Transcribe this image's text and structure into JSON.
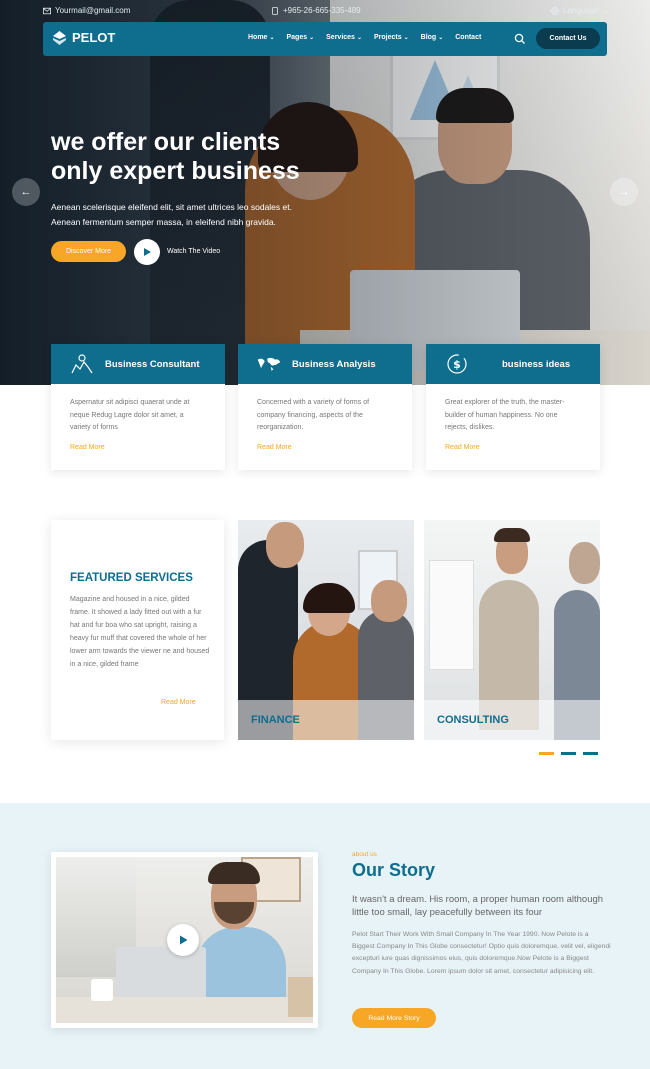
{
  "topbar": {
    "email": "Yourmail@gmail.com",
    "phone": "+965-26-665-335-489",
    "language": "Language"
  },
  "nav": {
    "brand": "PELOT",
    "links": [
      "Home",
      "Pages",
      "Services",
      "Projects",
      "Blog",
      "Contact"
    ],
    "contact_button": "Contact Us"
  },
  "hero": {
    "title_line1": "we offer our clients",
    "title_line2": "only expert business",
    "text_line1": "Aenean scelerisque eleifend elit, sit amet ultrices leo sodales et.",
    "text_line2": "Aenean fermentum semper massa, in eleifend nibh gravida.",
    "discover_button": "Discover More",
    "watch_label": "Watch The Video"
  },
  "services": [
    {
      "title": "Business Consultant",
      "icon": "person-chart-icon",
      "text": "Aspernatur sit adipisci quaerat unde at neque Redug Lagre dolor sit amet, a variety of forms",
      "read_more": "Read More"
    },
    {
      "title": "Business Analysis",
      "icon": "world-map-icon",
      "text": "Concerned with a variety of forms of company financing, aspects of the reorganization.",
      "read_more": "Read More"
    },
    {
      "title": "business ideas",
      "icon": "dollar-cycle-icon",
      "text": "Great explorer of the truth, the master-builder of human happiness. No one rejects, dislikes.",
      "read_more": "Read More"
    }
  ],
  "featured": {
    "title": "FEATURED SERVICES",
    "text": "Magazine and housed in a nice, gilded frame. It showed a lady fitted out with a fur hat and fur boa who sat upright, raising a heavy fur muff that covered the whole of her lower arm towards the viewer ne and housed in a nice, gilded frame",
    "read_more": "Read More",
    "cards": [
      {
        "caption": "FINANCE"
      },
      {
        "caption": "CONSULTING"
      }
    ]
  },
  "story": {
    "label": "about us",
    "title": "Our Story",
    "lead": "It wasn't a dream. His room, a proper human room although little too small, lay peacefully between its four",
    "text": "Pelot Start Their Work With Small Company In The Year 1990. Now Pelote is a Biggest Company In This Globe consectetur! Optio quis doloremque, velit vel, eligendi excepturi iure quas dignissimos eius, quis doloremque.Now Pelote is a Biggest Company In This Globe. Lorem ipsum dolor sit amet, consectetur adipisicing elit.",
    "button": "Read More Story"
  },
  "colors": {
    "primary": "#0f6d8e",
    "accent": "#f7a626",
    "dark": "#0a3b4f",
    "story_bg": "#e8f3f7"
  }
}
